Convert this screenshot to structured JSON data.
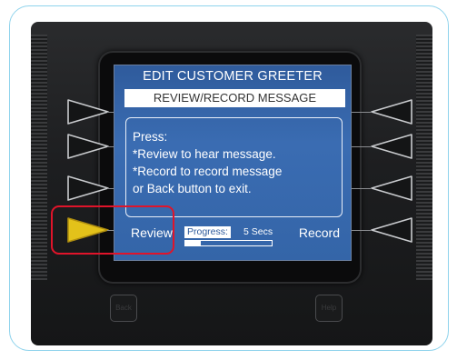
{
  "screen": {
    "title": "EDIT CUSTOMER GREETER",
    "subtitle": "REVIEW/RECORD MESSAGE",
    "message_lines": [
      "Press:",
      "*Review to hear message.",
      "*Record to record message",
      "or Back button to exit."
    ],
    "softkey_left": "Review",
    "softkey_right": "Record",
    "progress_label": "Progress:",
    "progress_time": "5 Secs",
    "progress_fraction": 0.18
  },
  "hardware_buttons": {
    "left": "Back",
    "right": "Help"
  },
  "colors": {
    "screen_blue": "#3465a8",
    "highlight_red": "#e0142a",
    "active_button": "#e3c21a",
    "frame_accent": "#8fd3ec"
  }
}
